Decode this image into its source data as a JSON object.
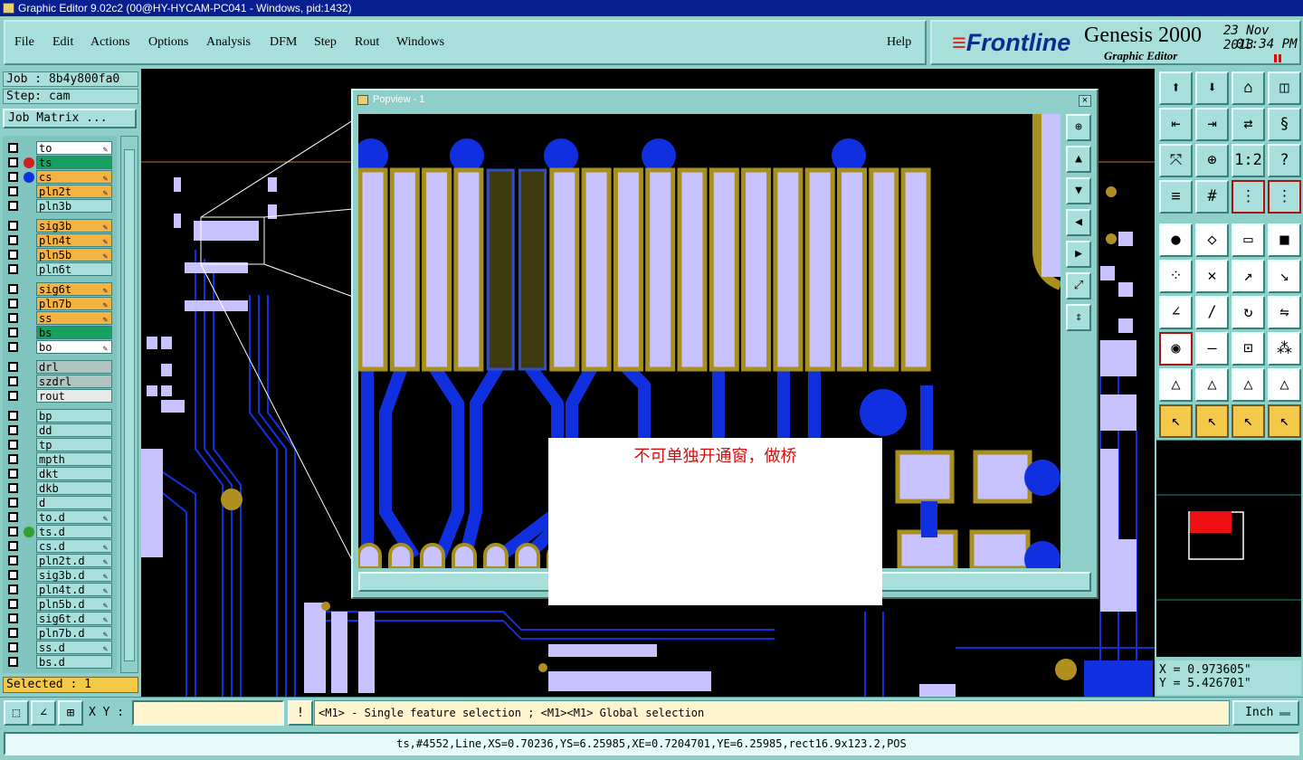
{
  "window": {
    "title": "Graphic Editor 9.02c2 (00@HY-HYCAM-PC041 - Windows, pid:1432)"
  },
  "menu": {
    "items": [
      "File",
      "Edit",
      "Actions",
      "Options",
      "Analysis",
      "DFM",
      "Step",
      "Rout",
      "Windows"
    ],
    "help": "Help"
  },
  "brand": {
    "logo": "Frontline",
    "product": "Genesis 2000",
    "subtitle": "Graphic Editor",
    "date": "23 Nov 2013",
    "time": "01:34 PM"
  },
  "job": {
    "job_label": "Job : 8b4y800fa0",
    "step_label": "Step: cam",
    "matrix_button": "Job Matrix ..."
  },
  "layers": [
    {
      "name": "to",
      "color": "#ffffff",
      "indicator": "",
      "edit": true
    },
    {
      "name": "ts",
      "color": "#18a060",
      "indicator": "#d02020",
      "edit": false,
      "active": true
    },
    {
      "name": "cs",
      "color": "#f4b240",
      "indicator": "#1030e0",
      "edit": true
    },
    {
      "name": "pln2t",
      "color": "#f4b240",
      "indicator": "",
      "edit": true
    },
    {
      "name": "pln3b",
      "color": "#a9dfdb",
      "indicator": "",
      "edit": false
    },
    {
      "name": "sig3b",
      "color": "#f4b240",
      "indicator": "",
      "edit": true
    },
    {
      "name": "pln4t",
      "color": "#f4b240",
      "indicator": "",
      "edit": true
    },
    {
      "name": "pln5b",
      "color": "#f4b240",
      "indicator": "",
      "edit": true
    },
    {
      "name": "pln6t",
      "color": "#a9dfdb",
      "indicator": "",
      "edit": false
    },
    {
      "name": "sig6t",
      "color": "#f4b240",
      "indicator": "",
      "edit": true
    },
    {
      "name": "pln7b",
      "color": "#f4b240",
      "indicator": "",
      "edit": true
    },
    {
      "name": "ss",
      "color": "#f4b240",
      "indicator": "",
      "edit": true
    },
    {
      "name": "bs",
      "color": "#18a060",
      "indicator": "",
      "edit": false
    },
    {
      "name": "bo",
      "color": "#ffffff",
      "indicator": "",
      "edit": true
    },
    {
      "name": "drl",
      "color": "#b0c4c4",
      "indicator": "",
      "edit": false
    },
    {
      "name": "szdrl",
      "color": "#b0c4c4",
      "indicator": "",
      "edit": false
    },
    {
      "name": "rout",
      "color": "#e8e8e8",
      "indicator": "",
      "edit": false
    },
    {
      "name": "bp",
      "color": "#a9dfdb",
      "indicator": "",
      "edit": false
    },
    {
      "name": "dd",
      "color": "#a9dfdb",
      "indicator": "",
      "edit": false
    },
    {
      "name": "tp",
      "color": "#a9dfdb",
      "indicator": "",
      "edit": false
    },
    {
      "name": "mpth",
      "color": "#a9dfdb",
      "indicator": "",
      "edit": false
    },
    {
      "name": "dkt",
      "color": "#a9dfdb",
      "indicator": "",
      "edit": false
    },
    {
      "name": "dkb",
      "color": "#a9dfdb",
      "indicator": "",
      "edit": false
    },
    {
      "name": "d",
      "color": "#a9dfdb",
      "indicator": "",
      "edit": false
    },
    {
      "name": "to.d",
      "color": "#a9dfdb",
      "indicator": "",
      "edit": true
    },
    {
      "name": "ts.d",
      "color": "#a9dfdb",
      "indicator": "#30a030",
      "edit": false
    },
    {
      "name": "cs.d",
      "color": "#a9dfdb",
      "indicator": "",
      "edit": true
    },
    {
      "name": "pln2t.d",
      "color": "#a9dfdb",
      "indicator": "",
      "edit": true
    },
    {
      "name": "sig3b.d",
      "color": "#a9dfdb",
      "indicator": "",
      "edit": true
    },
    {
      "name": "pln4t.d",
      "color": "#a9dfdb",
      "indicator": "",
      "edit": true
    },
    {
      "name": "pln5b.d",
      "color": "#a9dfdb",
      "indicator": "",
      "edit": true
    },
    {
      "name": "sig6t.d",
      "color": "#a9dfdb",
      "indicator": "",
      "edit": true
    },
    {
      "name": "pln7b.d",
      "color": "#a9dfdb",
      "indicator": "",
      "edit": true
    },
    {
      "name": "ss.d",
      "color": "#a9dfdb",
      "indicator": "",
      "edit": true
    },
    {
      "name": "bs.d",
      "color": "#a9dfdb",
      "indicator": "",
      "edit": false
    }
  ],
  "selected": "Selected : 1",
  "popview": {
    "title": "Popview - 1",
    "close": "×"
  },
  "note": {
    "text": "不可单独开通窗，做桥"
  },
  "right_tools": {
    "buttons": [
      "up-arrow",
      "down-arrow",
      "home",
      "window",
      "left-arrow",
      "right-arrow",
      "swap",
      "snake",
      "fit",
      "center",
      "1:2",
      "help",
      "sliders",
      "grid",
      "layers-red",
      "layers-red-2",
      "dot-circle",
      "shape",
      "ruler",
      "dot-box",
      "nodes",
      "cross",
      "connect",
      "node-arrow",
      "angle",
      "line",
      "rotate",
      "flip",
      "pad-red",
      "bar",
      "measure",
      "cluster",
      "triangle",
      "triangle-2",
      "triangle-3",
      "triangle-4",
      "select-yellow",
      "select-2",
      "select-3",
      "select-4"
    ],
    "label_1to2": "1:2"
  },
  "coords": {
    "x": "X = 0.973605\"",
    "y": "Y = 5.426701\""
  },
  "bottom": {
    "xy_label": "X Y :",
    "xy_value": "",
    "prompt": "<M1> - Single feature selection ; <M1><M1> Global selection",
    "units": "Inch",
    "status": "ts,#4552,Line,XS=0.70236,YS=6.25985,XE=0.7204701,YE=6.25985,rect16.9x123.2,POS",
    "bang": "!"
  },
  "colors": {
    "copper": "#1030e0",
    "pad_fill": "#c8c2ff",
    "pad_outline": "#a89020",
    "selected_pad": "#403a10",
    "background": "#000000"
  }
}
